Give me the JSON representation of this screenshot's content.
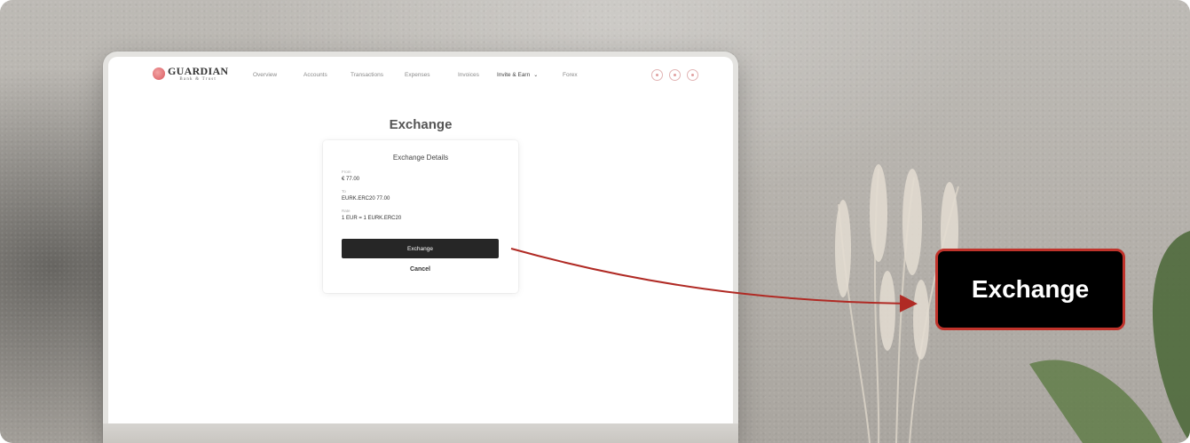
{
  "brand": {
    "name": "GUARDIAN",
    "tagline": "Bank & Trust"
  },
  "nav": {
    "items": [
      "Overview",
      "Accounts",
      "Transactions",
      "Expenses",
      "Invoices",
      "Invite & Earn",
      "Forex"
    ],
    "icons": [
      "notification-icon",
      "user-icon",
      "settings-icon"
    ]
  },
  "page": {
    "title": "Exchange"
  },
  "card": {
    "title": "Exchange Details",
    "from_label": "From",
    "from_value": "€ 77.00",
    "to_label": "To",
    "to_value": "EURK.ERC20 77.00",
    "rate_label": "Rate",
    "rate_value": "1 EUR = 1 EURK.ERC20",
    "exchange_button": "Exchange",
    "cancel_button": "Cancel"
  },
  "callout": {
    "label": "Exchange"
  },
  "colors": {
    "accent": "#c0332b",
    "button_dark": "#262626",
    "logo": "#d9585e"
  }
}
